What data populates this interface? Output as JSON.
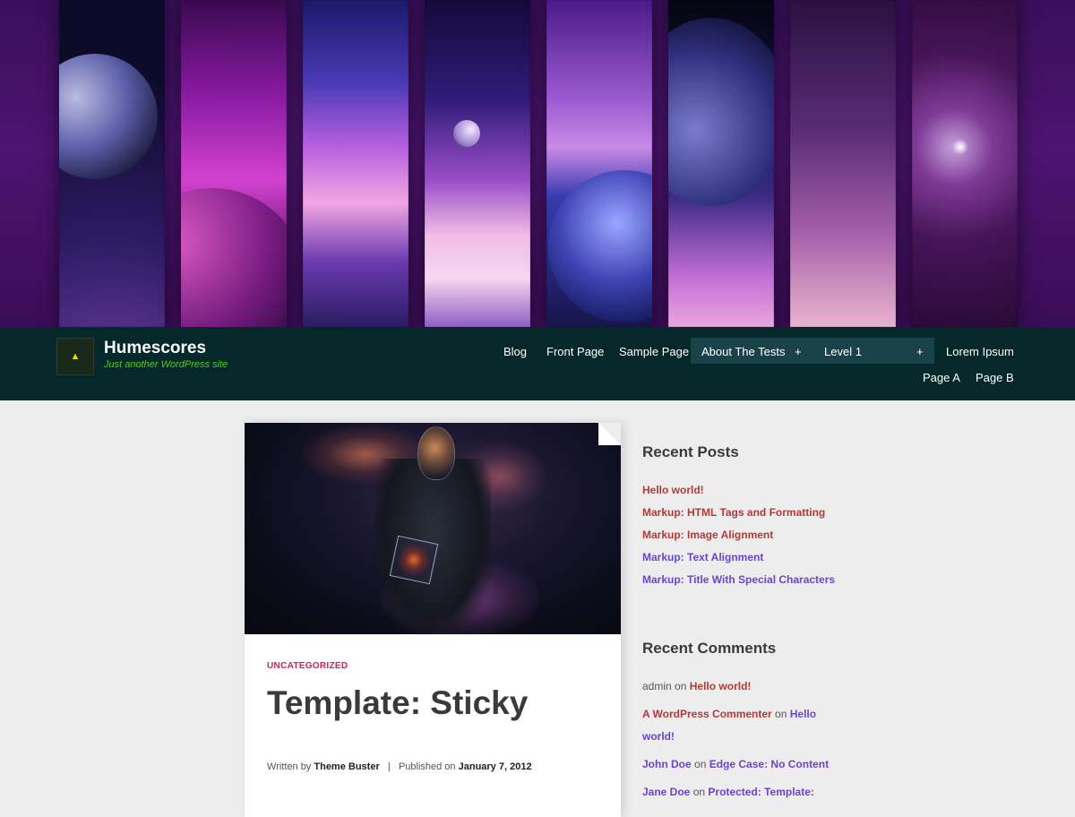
{
  "header": {
    "site_title": "Humescores",
    "site_description": "Just another WordPress site",
    "logo_icon": "triangle-logo-icon"
  },
  "nav": {
    "items": [
      "Blog",
      "Front Page",
      "Sample Page",
      "About The Tests",
      "Level 1",
      "Lorem Ipsum"
    ],
    "expand_glyph": "+",
    "second_row": [
      "Page A",
      "Page B"
    ]
  },
  "post": {
    "category": "UNCATEGORIZED",
    "title": "Template: Sticky",
    "written_by_label": "Written by",
    "author": "Theme Buster",
    "separator": "|",
    "published_label": "Published on",
    "date": "January 7, 2012"
  },
  "sidebar": {
    "recent_posts_title": "Recent Posts",
    "recent_posts": [
      "Hello world!",
      "Markup: HTML Tags and Formatting",
      "Markup: Image Alignment",
      "Markup: Text Alignment",
      "Markup: Title With Special Characters"
    ],
    "recent_comments_title": "Recent Comments",
    "comments": [
      {
        "author": "admin",
        "on": "on",
        "post": "Hello world!"
      },
      {
        "author": "A WordPress Commenter",
        "on": "on",
        "post_line1": "Hello",
        "post_line2": "world!"
      },
      {
        "author": "John Doe",
        "on": "on",
        "post": "Edge Case: No Content"
      },
      {
        "author": "Jane Doe",
        "on": "on",
        "post": "Protected: Template:"
      }
    ]
  },
  "colors": {
    "nav_bg": "#05282b",
    "link_red": "#b03a3a",
    "link_purple": "#6a45cc",
    "category": "#cc2255",
    "tagline_green": "#51cc1d"
  }
}
